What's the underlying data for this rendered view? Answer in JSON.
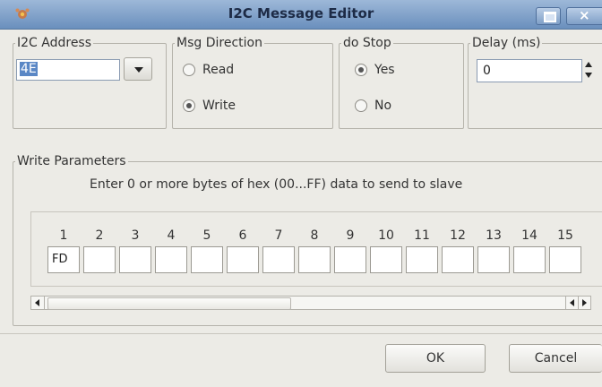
{
  "window": {
    "title": "I2C Message Editor",
    "icons": {
      "app": "app-icon",
      "minimize": "minimize-icon",
      "close": "close-icon"
    }
  },
  "address": {
    "legend": "I2C Address",
    "value": "4E"
  },
  "direction": {
    "legend": "Msg Direction",
    "options": [
      {
        "label": "Read",
        "selected": false
      },
      {
        "label": "Write",
        "selected": true
      }
    ]
  },
  "stop": {
    "legend": "do Stop",
    "options": [
      {
        "label": "Yes",
        "selected": true
      },
      {
        "label": "No",
        "selected": false
      }
    ]
  },
  "delay": {
    "legend": "Delay (ms)",
    "value": "0"
  },
  "write": {
    "legend": "Write Parameters",
    "description": "Enter 0 or more bytes of hex (00...FF) data to send to slave",
    "columns": [
      "1",
      "2",
      "3",
      "4",
      "5",
      "6",
      "7",
      "8",
      "9",
      "10",
      "11",
      "12",
      "13",
      "14",
      "15"
    ],
    "values": [
      "FD",
      "",
      "",
      "",
      "",
      "",
      "",
      "",
      "",
      "",
      "",
      "",
      "",
      "",
      ""
    ]
  },
  "buttons": {
    "ok": "OK",
    "cancel": "Cancel"
  },
  "colors": {
    "titlebar": "#7f9fc7",
    "window_bg": "#ecebe6",
    "selection": "#5a87c5"
  }
}
